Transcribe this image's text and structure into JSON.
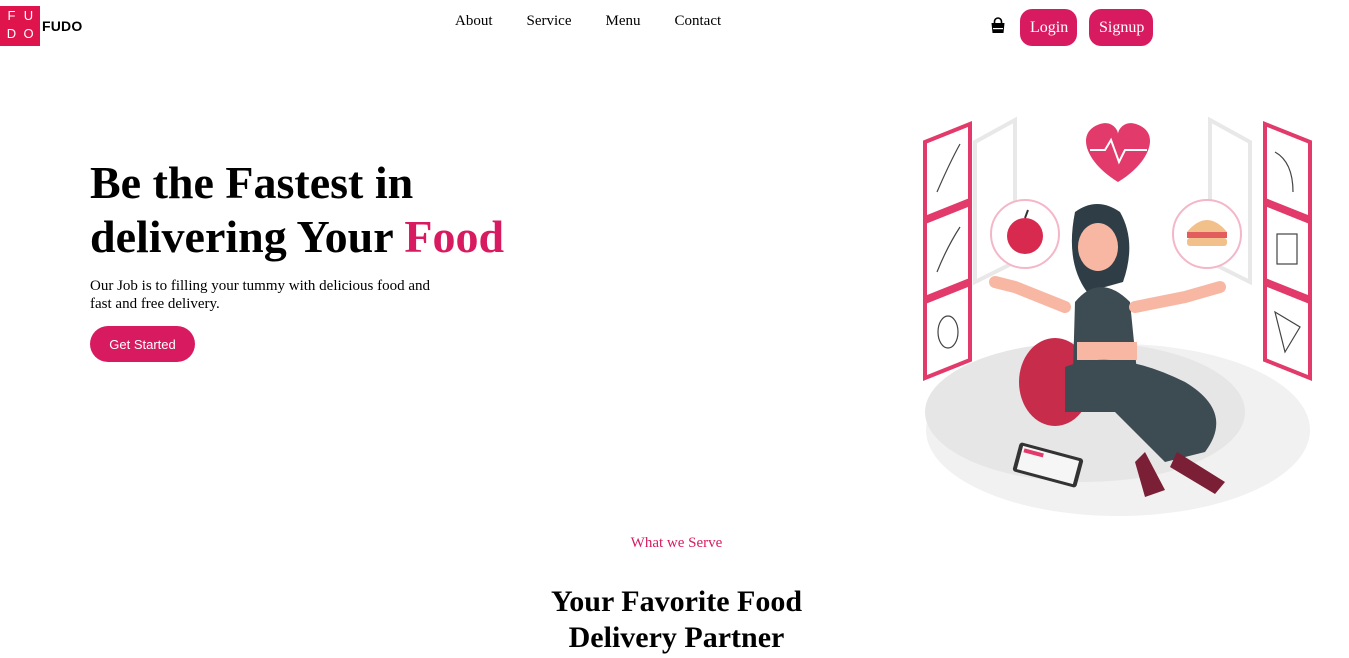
{
  "brand": {
    "mark_letters": [
      "F",
      "U",
      "D",
      "O"
    ],
    "name": "FUDO",
    "color": "#e0144c"
  },
  "nav": {
    "items": [
      {
        "label": "About"
      },
      {
        "label": "Service"
      },
      {
        "label": "Menu"
      },
      {
        "label": "Contact"
      }
    ]
  },
  "header": {
    "cart_icon": "shopping-bag-icon",
    "login_label": "Login",
    "signup_label": "Signup"
  },
  "hero": {
    "title_line1": "Be the Fastest in",
    "title_line2_prefix": "delivering Your ",
    "title_accent": "Food",
    "subtitle": "Our Job is to filling your tummy with delicious food and fast and free delivery.",
    "cta_label": "Get Started",
    "illustration": "woman-meditating-healthy-food-illustration"
  },
  "section": {
    "tag": "What we Serve",
    "title_line1": "Your Favorite Food",
    "title_line2": "Delivery Partner"
  },
  "colors": {
    "accent": "#d81b60"
  }
}
